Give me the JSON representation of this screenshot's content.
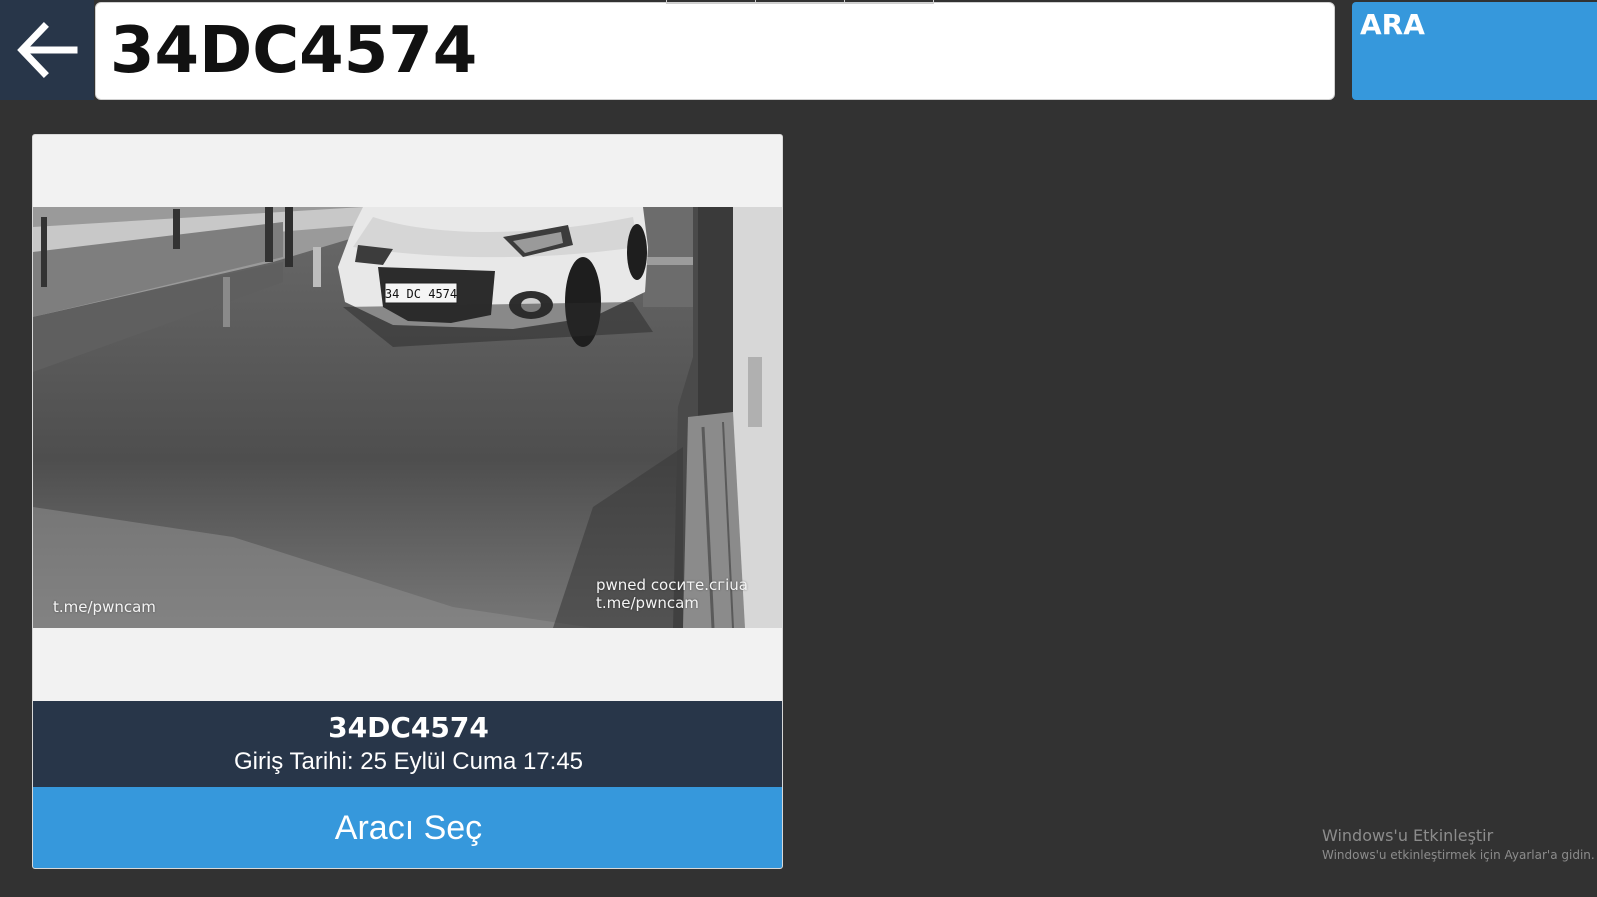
{
  "header": {
    "search_value": "34DC4574",
    "search_button_label": "ARA",
    "back_icon": "arrow-left-icon"
  },
  "result_card": {
    "plate": "34DC4574",
    "entry_date": "Giriş Tarihi: 25 Eylül Cuma 17:45",
    "select_button_label": "Aracı Seç",
    "photo": {
      "plate_on_car": "34 DC 4574",
      "watermark_left": "t.me/pwncam",
      "watermark_right_line1": "pwned cocите.сгiua",
      "watermark_right_line2": "t.me/pwncam"
    }
  },
  "system": {
    "activation_title": "Windows'u Etkinleştir",
    "activation_subtitle": "Windows'u etkinleştirmek için Ayarlar'a gidin."
  },
  "colors": {
    "background": "#323232",
    "navy": "#283649",
    "accent_blue": "#3698dc"
  }
}
